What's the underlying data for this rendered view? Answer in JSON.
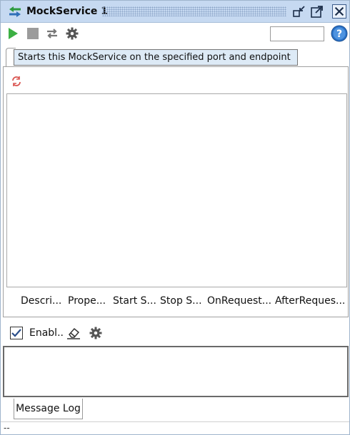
{
  "window": {
    "title": "MockService 1",
    "icons": {
      "title": "mockservice-icon",
      "minimize": "minimize-icon",
      "maximize": "maximize-icon",
      "close": "close-icon"
    }
  },
  "toolbar": {
    "start": "play-icon",
    "stop": "stop-icon",
    "options": "mock-options-icon",
    "settings": "gear-icon",
    "search_value": "",
    "help": "help-icon"
  },
  "tooltip": {
    "text": "Starts this MockService on the specified port and endpoint"
  },
  "panel": {
    "refresh": "refresh-icon",
    "tabs": [
      {
        "label": "Descri..."
      },
      {
        "label": "Prope..."
      },
      {
        "label": "Start S..."
      },
      {
        "label": "Stop S..."
      },
      {
        "label": "OnRequest..."
      },
      {
        "label": "AfterReques..."
      }
    ]
  },
  "log_controls": {
    "enable_label": "Enabl..",
    "enable_checked": true,
    "clear": "eraser-icon",
    "settings": "gear-icon"
  },
  "message_log": {
    "tab_label": "Message Log"
  },
  "status": {
    "text": "--"
  },
  "colors": {
    "titlebar": "#c6d9f1",
    "play": "#3cb043",
    "stop": "#9b9b9b",
    "tooltip_bg": "#ddeaf6",
    "help": "#2a72c8"
  }
}
